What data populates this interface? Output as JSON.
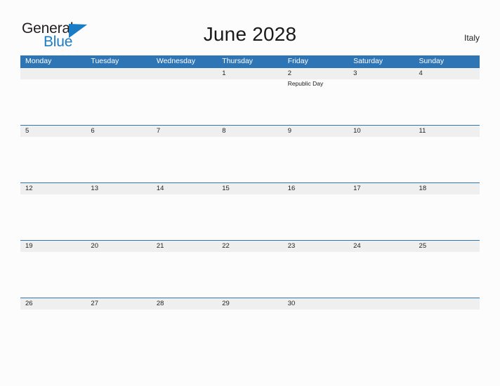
{
  "brand": {
    "name_part1": "General",
    "name_part2": "Blue",
    "flag_icon": "blue-triangle-flag-icon",
    "color_dark": "#231f20",
    "color_blue": "#1a7cc4"
  },
  "header": {
    "title": "June 2028",
    "country": "Italy"
  },
  "calendar": {
    "accent_color": "#2e75b6",
    "band_color": "#efefef",
    "weekdays": [
      "Monday",
      "Tuesday",
      "Wednesday",
      "Thursday",
      "Friday",
      "Saturday",
      "Sunday"
    ],
    "weeks": [
      {
        "days": [
          {
            "num": "",
            "events": []
          },
          {
            "num": "",
            "events": []
          },
          {
            "num": "",
            "events": []
          },
          {
            "num": "1",
            "events": []
          },
          {
            "num": "2",
            "events": [
              "Republic Day"
            ]
          },
          {
            "num": "3",
            "events": []
          },
          {
            "num": "4",
            "events": []
          }
        ]
      },
      {
        "days": [
          {
            "num": "5",
            "events": []
          },
          {
            "num": "6",
            "events": []
          },
          {
            "num": "7",
            "events": []
          },
          {
            "num": "8",
            "events": []
          },
          {
            "num": "9",
            "events": []
          },
          {
            "num": "10",
            "events": []
          },
          {
            "num": "11",
            "events": []
          }
        ]
      },
      {
        "days": [
          {
            "num": "12",
            "events": []
          },
          {
            "num": "13",
            "events": []
          },
          {
            "num": "14",
            "events": []
          },
          {
            "num": "15",
            "events": []
          },
          {
            "num": "16",
            "events": []
          },
          {
            "num": "17",
            "events": []
          },
          {
            "num": "18",
            "events": []
          }
        ]
      },
      {
        "days": [
          {
            "num": "19",
            "events": []
          },
          {
            "num": "20",
            "events": []
          },
          {
            "num": "21",
            "events": []
          },
          {
            "num": "22",
            "events": []
          },
          {
            "num": "23",
            "events": []
          },
          {
            "num": "24",
            "events": []
          },
          {
            "num": "25",
            "events": []
          }
        ]
      },
      {
        "days": [
          {
            "num": "26",
            "events": []
          },
          {
            "num": "27",
            "events": []
          },
          {
            "num": "28",
            "events": []
          },
          {
            "num": "29",
            "events": []
          },
          {
            "num": "30",
            "events": []
          },
          {
            "num": "",
            "events": []
          },
          {
            "num": "",
            "events": []
          }
        ]
      }
    ]
  }
}
